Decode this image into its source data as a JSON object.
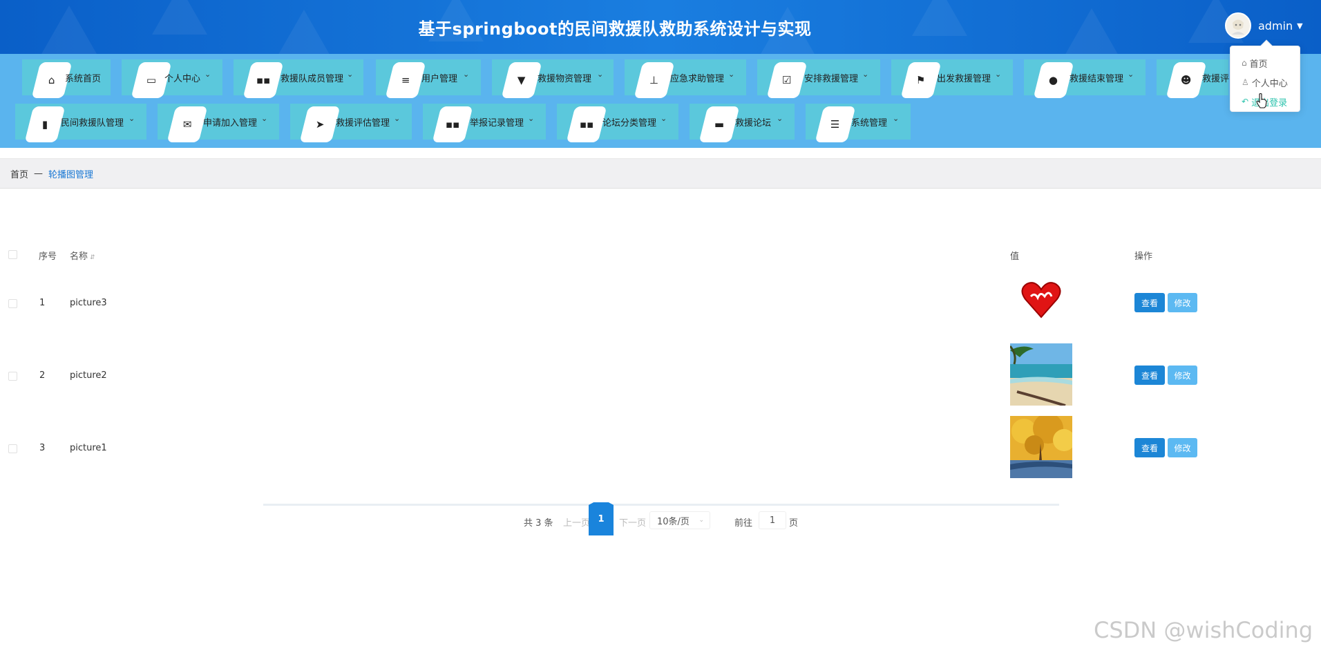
{
  "header": {
    "title": "基于springboot的民间救援队救助系统设计与实现",
    "username": "admin"
  },
  "user_menu": [
    {
      "label": "首页",
      "icon": "home-icon"
    },
    {
      "label": "个人中心",
      "icon": "user-icon"
    },
    {
      "label": "退出登录",
      "icon": "logout-icon",
      "active": true
    }
  ],
  "nav": {
    "row1": [
      {
        "label": "系统首页",
        "icon": "home-icon",
        "dropdown": false
      },
      {
        "label": "个人中心",
        "icon": "card-icon",
        "dropdown": true
      },
      {
        "label": "救援队成员管理",
        "icon": "grid-icon",
        "dropdown": true
      },
      {
        "label": "用户管理",
        "icon": "sliders-icon",
        "dropdown": true
      },
      {
        "label": "救援物资管理",
        "icon": "brush-icon",
        "dropdown": true
      },
      {
        "label": "应急求助管理",
        "icon": "stamp-icon",
        "dropdown": true
      },
      {
        "label": "安排救援管理",
        "icon": "clipboard-check-icon",
        "dropdown": true
      },
      {
        "label": "出发救援管理",
        "icon": "flag-icon",
        "dropdown": true
      },
      {
        "label": "救援结束管理",
        "icon": "bulb-icon",
        "dropdown": true
      },
      {
        "label": "救援评",
        "icon": "person-icon",
        "dropdown": false
      }
    ],
    "row2": [
      {
        "label": "民间救援队管理",
        "icon": "book-icon",
        "dropdown": true
      },
      {
        "label": "申请加入管理",
        "icon": "mailbox-icon",
        "dropdown": true
      },
      {
        "label": "救援评估管理",
        "icon": "send-icon",
        "dropdown": true
      },
      {
        "label": "举报记录管理",
        "icon": "grid-icon",
        "dropdown": true
      },
      {
        "label": "论坛分类管理",
        "icon": "grid-icon",
        "dropdown": true
      },
      {
        "label": "救援论坛",
        "icon": "chat-icon",
        "dropdown": true
      },
      {
        "label": "系统管理",
        "icon": "menu-icon",
        "dropdown": true
      }
    ]
  },
  "breadcrumb": {
    "home": "首页",
    "separator": "—",
    "current": "轮播图管理"
  },
  "table": {
    "headers": {
      "index": "序号",
      "name": "名称",
      "value": "值",
      "actions": "操作"
    },
    "rows": [
      {
        "index": "1",
        "name": "picture3",
        "image": "heart-image"
      },
      {
        "index": "2",
        "name": "picture2",
        "image": "beach-image"
      },
      {
        "index": "3",
        "name": "picture1",
        "image": "autumn-tree-image"
      }
    ],
    "view_label": "查看",
    "edit_label": "修改"
  },
  "pagination": {
    "total": "共 3 条",
    "prev": "上一页",
    "current_page": "1",
    "next": "下一页",
    "page_size": "10条/页",
    "goto_label": "前往",
    "goto_value": "1",
    "page_unit": "页"
  },
  "watermark": "CSDN @wishCoding"
}
